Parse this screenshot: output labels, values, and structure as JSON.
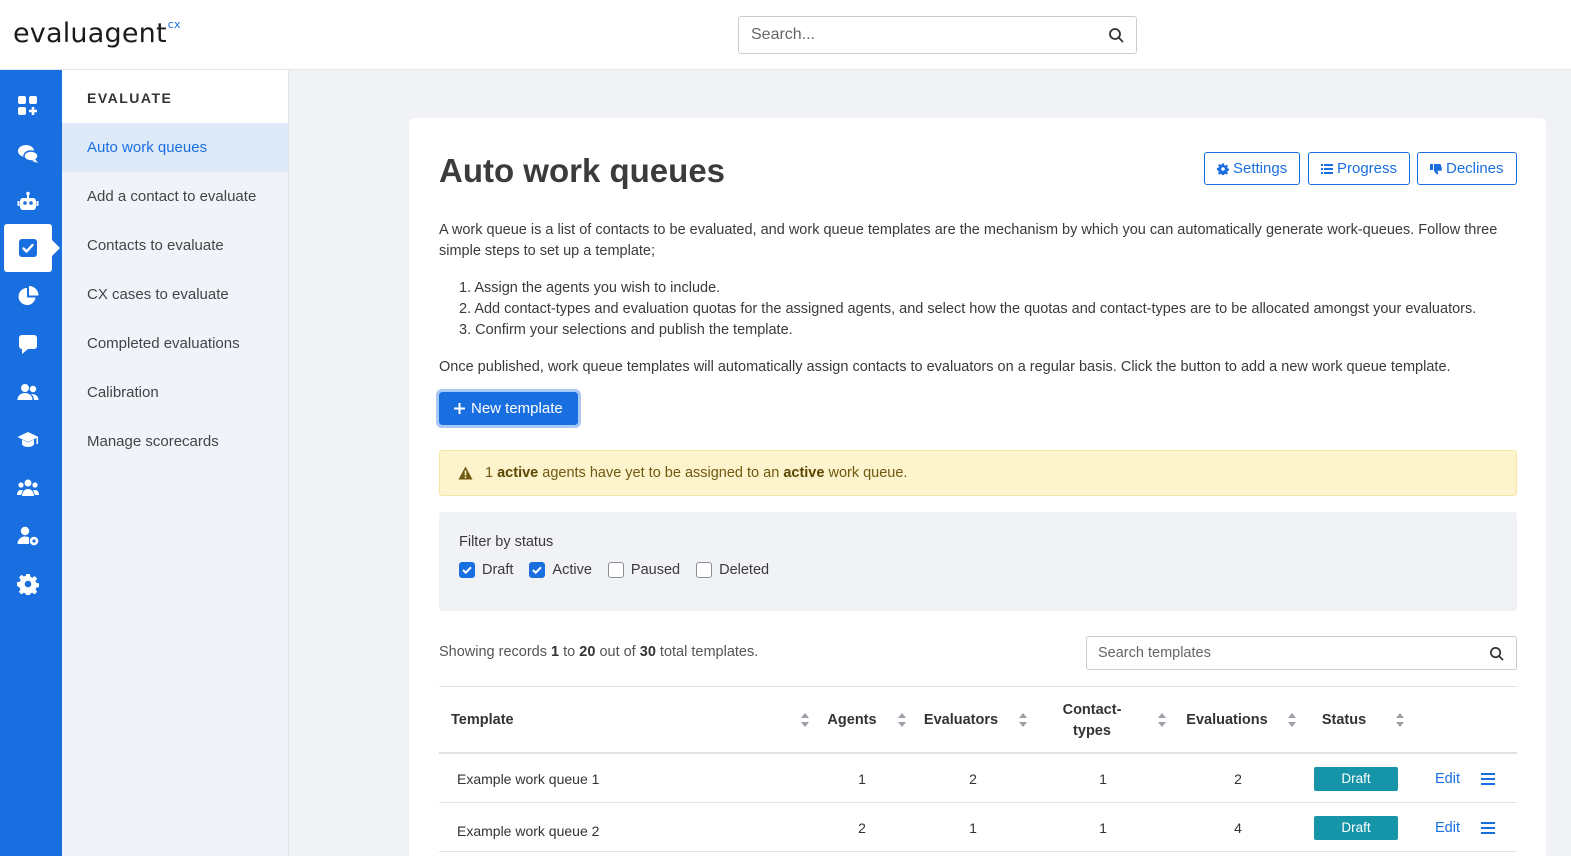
{
  "app": {
    "logo_text": "evaluagent",
    "logo_sup": "cx",
    "search_placeholder": "Search..."
  },
  "rail": {
    "icons": [
      "dashboard-add-icon",
      "chat-bubbles-icon",
      "robot-icon",
      "checkbox-icon",
      "pie-chart-icon",
      "comment-icon",
      "users-icon",
      "graduation-cap-icon",
      "team-icon",
      "user-settings-icon",
      "gear-icon"
    ],
    "active_index": 3
  },
  "subnav": {
    "heading": "EVALUATE",
    "items": [
      {
        "label": "Auto work queues",
        "active": true
      },
      {
        "label": "Add a contact to evaluate"
      },
      {
        "label": "Contacts to evaluate"
      },
      {
        "label": "CX cases to evaluate"
      },
      {
        "label": "Completed evaluations"
      },
      {
        "label": "Calibration"
      },
      {
        "label": "Manage scorecards"
      }
    ]
  },
  "page": {
    "title": "Auto work queues",
    "buttons": {
      "settings": "Settings",
      "progress": "Progress",
      "declines": "Declines"
    },
    "intro": "A work queue is a list of contacts to be evaluated, and work queue templates are the mechanism by which you can automatically generate work-queues. Follow three simple steps to set up a template;",
    "steps": [
      "1. Assign the agents you wish to include.",
      "2. Add contact-types and evaluation quotas for the assigned agents, and select how the quotas and contact-types are to be allocated amongst your evaluators.",
      "3. Confirm your selections and publish the template."
    ],
    "outro": "Once published, work queue templates will automatically assign contacts to evaluators on a regular basis. Click the button to add a new work queue template.",
    "new_template": "New template",
    "alert": {
      "count": "1",
      "w1": "active",
      "mid": "agents have yet to be assigned to an",
      "w2": "active",
      "end": "work queue."
    },
    "filter": {
      "label": "Filter by status",
      "options": [
        {
          "label": "Draft",
          "checked": true
        },
        {
          "label": "Active",
          "checked": true
        },
        {
          "label": "Paused",
          "checked": false
        },
        {
          "label": "Deleted",
          "checked": false
        }
      ]
    },
    "records": {
      "prefix": "Showing records",
      "from": "1",
      "to_word": "to",
      "to": "20",
      "out_of": "out of",
      "total": "30",
      "suffix": "total templates."
    },
    "template_search_placeholder": "Search templates"
  },
  "table": {
    "headers": {
      "template": "Template",
      "agents": "Agents",
      "evaluators": "Evaluators",
      "contact_types": "Contact-\ntypes",
      "evaluations": "Evaluations",
      "status": "Status"
    },
    "rows": [
      {
        "template": "Example work queue 1",
        "agents": "1",
        "evaluators": "2",
        "contact_types": "1",
        "evaluations": "2",
        "status": "Draft",
        "edit": "Edit"
      },
      {
        "template": "Example work queue 2",
        "agents": "2",
        "evaluators": "1",
        "contact_types": "1",
        "evaluations": "4",
        "status": "Draft",
        "edit": "Edit"
      }
    ]
  },
  "colors": {
    "primary": "#1a6fe0",
    "badge": "#1795a8",
    "alert_bg": "#fdf3cd"
  }
}
